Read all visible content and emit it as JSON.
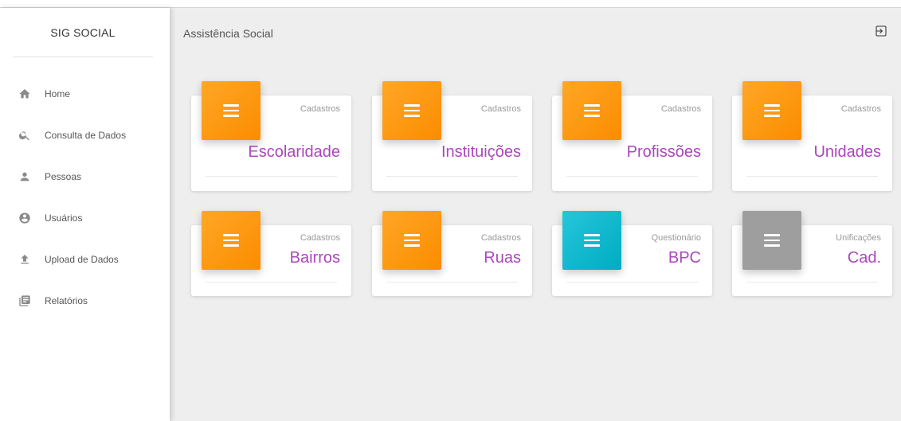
{
  "app": {
    "brand": "SIG SOCIAL"
  },
  "header": {
    "title": "Assistência Social"
  },
  "sidebar": {
    "items": [
      {
        "label": "Home",
        "icon": "home-icon"
      },
      {
        "label": "Consulta de Dados",
        "icon": "search-icon"
      },
      {
        "label": "Pessoas",
        "icon": "person-icon"
      },
      {
        "label": "Usuários",
        "icon": "account-circle-icon"
      },
      {
        "label": "Upload de Dados",
        "icon": "upload-icon"
      },
      {
        "label": "Relatórios",
        "icon": "reports-icon"
      }
    ]
  },
  "cards": [
    {
      "category": "Cadastros",
      "name": "Escolaridade",
      "color": "#fb8c00"
    },
    {
      "category": "Cadastros",
      "name": "Instituições",
      "color": "#fb8c00"
    },
    {
      "category": "Cadastros",
      "name": "Profissões",
      "color": "#fb8c00"
    },
    {
      "category": "Cadastros",
      "name": "Unidades",
      "color": "#fb8c00"
    },
    {
      "category": "Cadastros",
      "name": "Bairros",
      "color": "#fb8c00"
    },
    {
      "category": "Cadastros",
      "name": "Ruas",
      "color": "#fb8c00"
    },
    {
      "category": "Questionário",
      "name": "BPC",
      "color": "#00acc1"
    },
    {
      "category": "Unificações",
      "name": "Cad.",
      "color": "#9e9e9e"
    }
  ],
  "colors": {
    "accent_text": "#ab47bc",
    "orange": "#fb8c00",
    "cyan": "#00acc1",
    "gray": "#9e9e9e"
  }
}
